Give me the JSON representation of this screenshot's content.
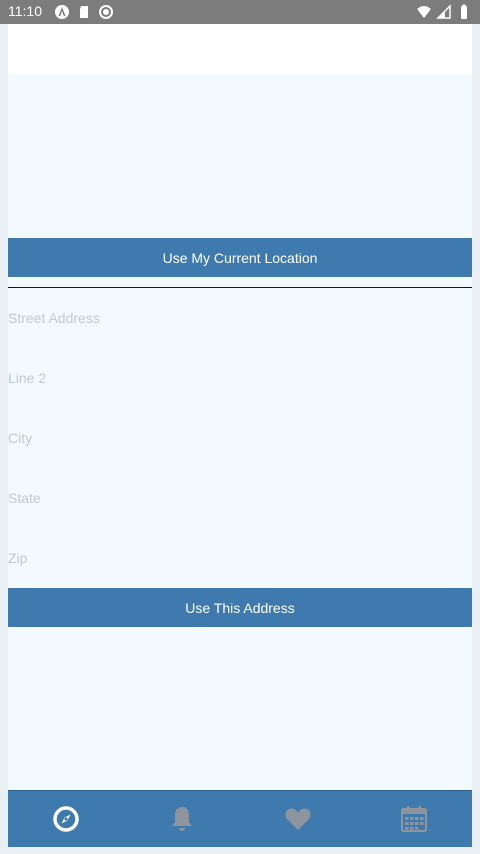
{
  "status_bar": {
    "time": "11:10",
    "left_icons": [
      "android-auto-icon",
      "sd-card-icon",
      "sync-icon"
    ],
    "right_icons": [
      "wifi-icon",
      "cell-signal-icon",
      "battery-icon"
    ]
  },
  "location": {
    "current_location_button": "Use My Current Location"
  },
  "address_form": {
    "street_placeholder": "Street Address",
    "line2_placeholder": "Line 2",
    "city_placeholder": "City",
    "state_placeholder": "State",
    "zip_placeholder": "Zip",
    "submit_button": "Use This Address"
  },
  "tab_bar": {
    "tabs": [
      {
        "icon": "compass-icon",
        "active": true
      },
      {
        "icon": "bell-icon",
        "active": false
      },
      {
        "icon": "heart-icon",
        "active": false
      },
      {
        "icon": "calendar-icon",
        "active": false
      }
    ]
  },
  "colors": {
    "primary": "#3f7aaf",
    "background": "#f2fafe",
    "active_icon": "#ffffff",
    "inactive_icon": "#8e959c"
  }
}
